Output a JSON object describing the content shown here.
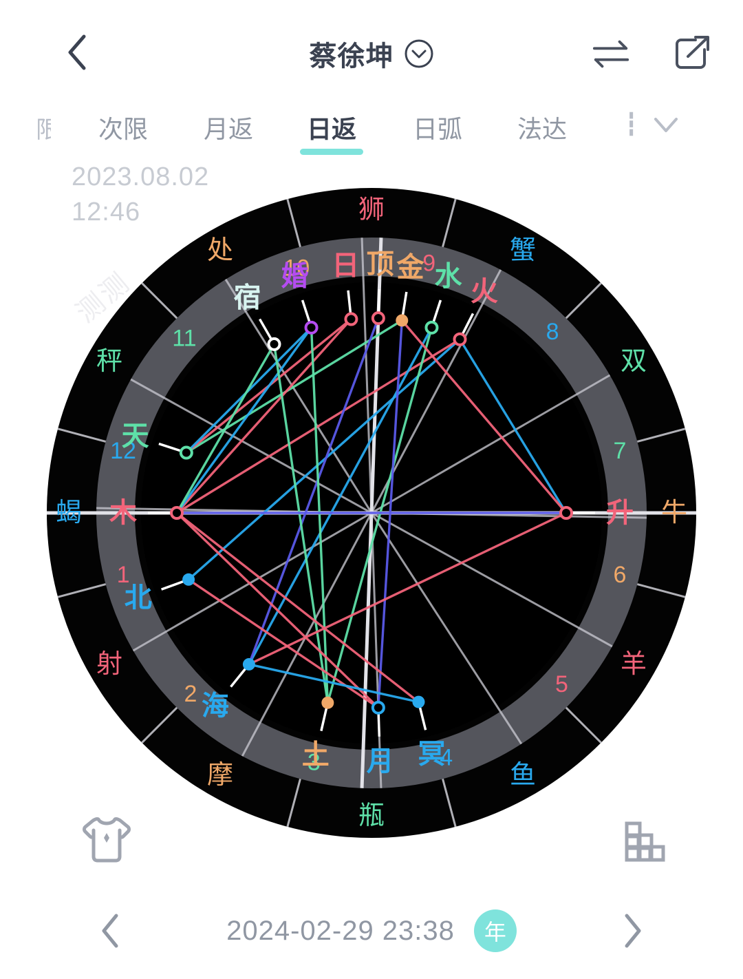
{
  "header": {
    "back_icon": "chevron-left-icon",
    "title": "蔡徐坤",
    "title_dropdown_icon": "chevron-down-circle-icon",
    "swap_icon": "swap-arrows-icon",
    "share_icon": "share-external-icon"
  },
  "tabs": {
    "left_edge_label": "限",
    "items": [
      {
        "label": "次限",
        "active": false
      },
      {
        "label": "月返",
        "active": false
      },
      {
        "label": "日返",
        "active": true
      },
      {
        "label": "日弧",
        "active": false
      },
      {
        "label": "法达",
        "active": false
      }
    ],
    "more_label": "┇",
    "expand_icon": "chevron-down-icon"
  },
  "overlay": {
    "date": "2023.08.02",
    "time": "12:46",
    "watermark": "测测"
  },
  "footer": {
    "tshirt_icon": "tshirt-sparkle-icon",
    "grid_icon": "bar-grid-icon"
  },
  "bottom_bar": {
    "prev_icon": "chevron-left-icon",
    "datetime": "2024-02-29 23:38",
    "unit_badge": "年",
    "next_icon": "chevron-right-icon"
  },
  "colors": {
    "accent": "#7fe3dc",
    "header_text": "#3b4251",
    "muted_text": "#9097a3",
    "ring_outer": "#000000",
    "ring_band": "#54555c",
    "cusp_line": "#c8c8d0",
    "pink": "#f2647a",
    "green": "#5ee0a8",
    "blue": "#29a9ee",
    "orange": "#f0a868",
    "purple": "#b44cf0",
    "indigo": "#5a5ae8",
    "white": "#f0f0f5"
  },
  "chart_data": {
    "type": "astrology-wheel",
    "title": "日返 chart",
    "center": [
      540,
      500
    ],
    "radius_outer": 472,
    "radius_band_outer": 400,
    "radius_band_inner": 344,
    "radius_inner": 335,
    "ascendant_angle_deg": 180,
    "zodiac_signs": [
      {
        "name": "狮",
        "angle": 90,
        "color": "#f2647a"
      },
      {
        "name": "蟹",
        "angle": 120,
        "color": "#29a9ee"
      },
      {
        "name": "双",
        "angle": 150,
        "color": "#5ee0a8"
      },
      {
        "name": "牛",
        "angle": 180,
        "color": "#f0a868"
      },
      {
        "name": "羊",
        "angle": 210,
        "color": "#f2647a"
      },
      {
        "name": "鱼",
        "angle": 240,
        "color": "#29a9ee"
      },
      {
        "name": "瓶",
        "angle": 270,
        "color": "#5ee0a8"
      },
      {
        "name": "摩",
        "angle": 300,
        "color": "#f0a868"
      },
      {
        "name": "射",
        "angle": 330,
        "color": "#f2647a"
      },
      {
        "name": "蝎",
        "angle": 0,
        "color": "#29a9ee"
      },
      {
        "name": "秤",
        "angle": 30,
        "color": "#5ee0a8"
      },
      {
        "name": "处",
        "angle": 60,
        "color": "#f0a868"
      }
    ],
    "houses": [
      {
        "number": "1",
        "angle": 346,
        "color": "#f2647a"
      },
      {
        "number": "2",
        "angle": 315,
        "color": "#f0a868"
      },
      {
        "number": "3",
        "angle": 283,
        "color": "#5ee0a8"
      },
      {
        "number": "4",
        "angle": 253,
        "color": "#29a9ee"
      },
      {
        "number": "5",
        "angle": 222,
        "color": "#f2647a"
      },
      {
        "number": "6",
        "angle": 194,
        "color": "#f0a868"
      },
      {
        "number": "7",
        "angle": 166,
        "color": "#5ee0a8"
      },
      {
        "number": "8",
        "angle": 135,
        "color": "#29a9ee"
      },
      {
        "number": "9",
        "angle": 103,
        "color": "#f2647a"
      },
      {
        "number": "10",
        "angle": 73,
        "color": "#f0a868"
      },
      {
        "number": "11",
        "angle": 43,
        "color": "#5ee0a8"
      },
      {
        "number": "12",
        "angle": 14,
        "color": "#29a9ee"
      }
    ],
    "planets": [
      {
        "name": "火",
        "angle": 117,
        "color": "#f2647a",
        "marker": "ring",
        "marker_color": "#f2647a"
      },
      {
        "name": "水",
        "angle": 108,
        "color": "#5ee0a8",
        "marker": "ring",
        "marker_color": "#5ee0a8"
      },
      {
        "name": "金",
        "angle": 99,
        "color": "#f0a868",
        "marker": "filled",
        "marker_color": "#f0a868"
      },
      {
        "name": "顶",
        "angle": 92,
        "color": "#f0a868",
        "marker": "ring",
        "marker_color": "#f2647a"
      },
      {
        "name": "日",
        "angle": 84,
        "color": "#f2647a",
        "marker": "ring",
        "marker_color": "#f2647a"
      },
      {
        "name": "婚",
        "angle": 72,
        "color": "#b44cf0",
        "marker": "ring",
        "marker_color": "#b44cf0"
      },
      {
        "name": "宿",
        "angle": 60,
        "color": "#d8f4f0",
        "marker": "ring",
        "marker_color": "#ffffff"
      },
      {
        "name": "天",
        "angle": 18,
        "color": "#5ee0a8",
        "marker": "ring",
        "marker_color": "#5ee0a8"
      },
      {
        "name": "木",
        "angle": 0,
        "color": "#f2647a",
        "marker": "ring",
        "marker_color": "#f2647a"
      },
      {
        "name": "北",
        "angle": 340,
        "color": "#29a9ee",
        "marker": "filled",
        "marker_color": "#29a9ee"
      },
      {
        "name": "海",
        "angle": 309,
        "color": "#29a9ee",
        "marker": "filled",
        "marker_color": "#29a9ee"
      },
      {
        "name": "土",
        "angle": 283,
        "color": "#f0a868",
        "marker": "filled",
        "marker_color": "#f0a868"
      },
      {
        "name": "月",
        "angle": 268,
        "color": "#29a9ee",
        "marker": "ring",
        "marker_color": "#29a9ee"
      },
      {
        "name": "冥",
        "angle": 256,
        "color": "#29a9ee",
        "marker": "filled",
        "marker_color": "#29a9ee"
      }
    ],
    "aspects": [
      {
        "from": "火",
        "to": "北",
        "color": "#29a9ee"
      },
      {
        "from": "火",
        "to": "木",
        "color": "#f2647a"
      },
      {
        "from": "水",
        "to": "土",
        "color": "#5ee0a8"
      },
      {
        "from": "水",
        "to": "海",
        "color": "#29a9ee"
      },
      {
        "from": "金",
        "to": "天",
        "color": "#5ee0a8"
      },
      {
        "from": "金",
        "to": "月",
        "color": "#5a5ae8"
      },
      {
        "from": "顶",
        "to": "海",
        "color": "#5a5ae8"
      },
      {
        "from": "日",
        "to": "木",
        "color": "#f2647a"
      },
      {
        "from": "日",
        "to": "天",
        "color": "#f2647a"
      },
      {
        "from": "婚",
        "to": "天",
        "color": "#29a9ee"
      },
      {
        "from": "婚",
        "to": "木",
        "color": "#29a9ee"
      },
      {
        "from": "婚",
        "to": "土",
        "color": "#5ee0a8"
      },
      {
        "from": "宿",
        "to": "木",
        "color": "#5ee0a8"
      },
      {
        "from": "宿",
        "to": "土",
        "color": "#5ee0a8"
      },
      {
        "from": "木",
        "to": "冥",
        "color": "#f2647a"
      },
      {
        "from": "木",
        "to": "月",
        "color": "#f2647a"
      },
      {
        "from": "北",
        "to": "月",
        "color": "#f2647a"
      },
      {
        "from": "海",
        "to": "冥",
        "color": "#29a9ee"
      },
      {
        "from": "升",
        "to": "木",
        "color": "#5a5ae8"
      },
      {
        "from": "升",
        "to": "火",
        "color": "#29a9ee"
      },
      {
        "from": "升",
        "to": "金",
        "color": "#f2647a"
      },
      {
        "from": "升",
        "to": "海",
        "color": "#f2647a"
      }
    ],
    "angles": [
      {
        "name": "升",
        "angle": 180,
        "color": "#f2647a",
        "marker": "ring",
        "marker_color": "#f2647a"
      }
    ]
  }
}
